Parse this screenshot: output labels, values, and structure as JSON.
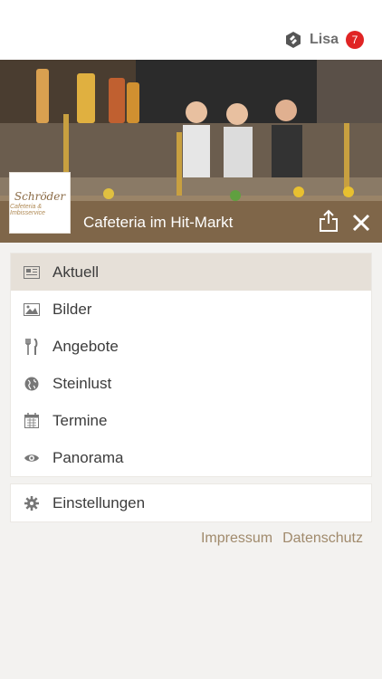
{
  "user": {
    "name": "Lisa",
    "badge_count": "7",
    "logo_icon": "hexagon-logo-icon"
  },
  "hero": {
    "title": "Cafeteria im Hit-Markt",
    "logo_line1": "Schröder",
    "logo_line2": "Cafeteria & Imbisservice"
  },
  "menu": {
    "items": [
      {
        "label": "Aktuell",
        "icon": "newspaper-icon",
        "active": true
      },
      {
        "label": "Bilder",
        "icon": "image-icon",
        "active": false
      },
      {
        "label": "Angebote",
        "icon": "cutlery-icon",
        "active": false
      },
      {
        "label": "Steinlust",
        "icon": "globe-icon",
        "active": false
      },
      {
        "label": "Termine",
        "icon": "calendar-icon",
        "active": false
      },
      {
        "label": "Panorama",
        "icon": "eye-icon",
        "active": false
      }
    ],
    "settings_label": "Einstellungen"
  },
  "footer": {
    "impressum": "Impressum",
    "datenschutz": "Datenschutz"
  },
  "colors": {
    "accent": "#7d6446",
    "badge": "#e02424",
    "active_bg": "#e6e0d8",
    "link": "#a08a6c"
  }
}
